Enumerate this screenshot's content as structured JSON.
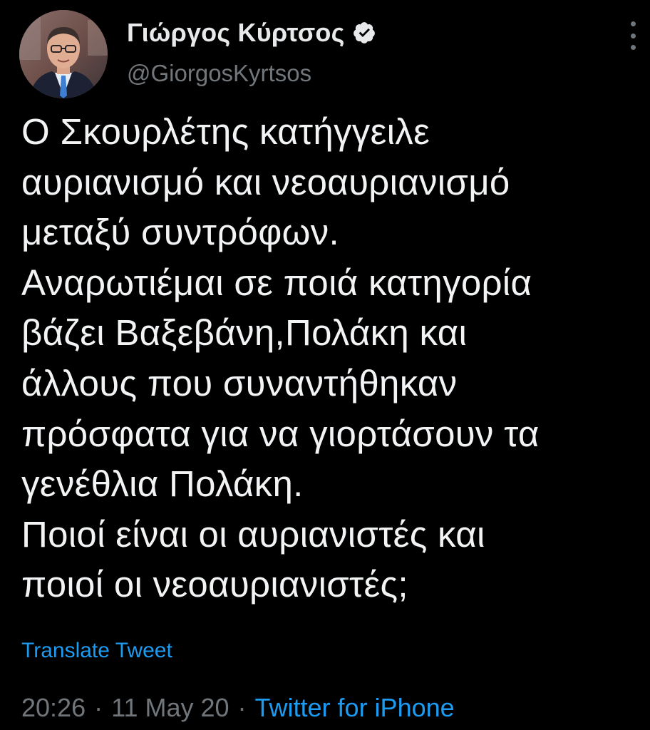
{
  "author": {
    "display_name": "Γιώργος Κύρτσος",
    "handle": "@GiorgosKyrtsos",
    "verified": true
  },
  "tweet": {
    "lines": [
      "Ο Σκουρλέτης κατήγγειλε",
      "αυριανισμό και νεοαυριανισμό",
      "μεταξύ συντρόφων.",
      "Αναρωτιέμαι σε ποιά κατηγορία",
      "βάζει Βαξεβάνη,Πολάκη και",
      "άλλους που συναντήθηκαν",
      "πρόσφατα για να γιορτάσουν τα",
      "γενέθλια Πολάκη.",
      "Ποιοί είναι οι αυριανιστές και",
      "ποιοί οι νεοαυριανιστές;"
    ],
    "translate_label": "Translate Tweet"
  },
  "meta": {
    "time": "20:26",
    "separator": "·",
    "date": "11 May 20",
    "source": "Twitter for iPhone"
  },
  "icons": {
    "verified": "verified-badge-icon",
    "more": "more-options-icon"
  },
  "colors": {
    "background": "#000000",
    "text": "#e7e9ea",
    "secondary": "#71767b",
    "link": "#1d9bf0"
  }
}
